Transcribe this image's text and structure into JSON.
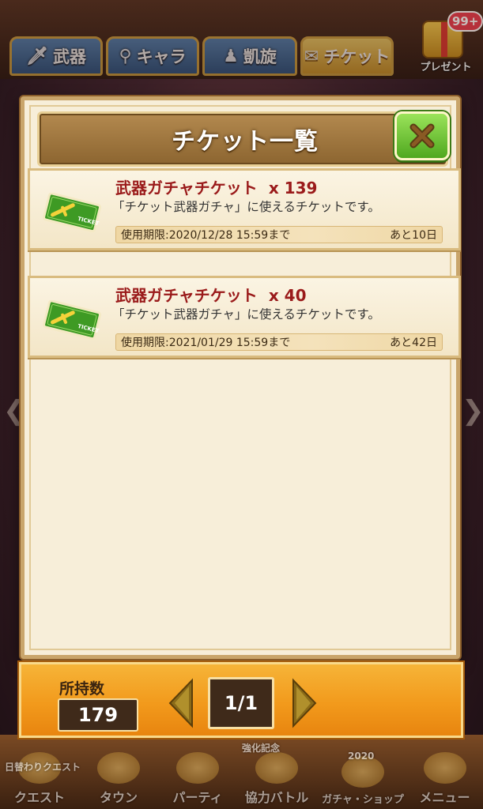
{
  "top_tabs": [
    {
      "label": "武器",
      "icon": "sword-icon",
      "active": false
    },
    {
      "label": "キャラ",
      "icon": "keyhole-icon",
      "active": false
    },
    {
      "label": "凱旋",
      "icon": "person-icon",
      "active": false
    },
    {
      "label": "チケット",
      "icon": "ticket-icon",
      "active": true
    }
  ],
  "present": {
    "badge": "99+",
    "label": "プレゼント"
  },
  "modal": {
    "title": "チケット一覧",
    "close_icon": "close-x-icon",
    "accent_color": "#5bbf24"
  },
  "tickets": [
    {
      "name": "武器ガチャチケット",
      "quantity": "x 139",
      "description": "「チケット武器ガチャ」に使えるチケットです。",
      "expiry": "使用期限:2020/12/28  15:59まで",
      "remaining": "あと10日",
      "icon": "green-sword-ticket-icon"
    },
    {
      "name": "武器ガチャチケット",
      "quantity": "x 40",
      "description": "「チケット武器ガチャ」に使えるチケットです。",
      "expiry": "使用期限:2021/01/29  15:59まで",
      "remaining": "あと42日",
      "icon": "green-sword-ticket-icon"
    }
  ],
  "footer": {
    "holdings_label": "所持数",
    "holdings_value": "179",
    "page": "1/1"
  },
  "background_banners": {
    "daily_quest": "日替わりクエスト",
    "strengthen": "強化記念",
    "year": "2020"
  },
  "bottom_nav": [
    "クエスト",
    "タウン",
    "パーティ",
    "協力バトル",
    "ガチャ・ショップ",
    "メニュー"
  ]
}
